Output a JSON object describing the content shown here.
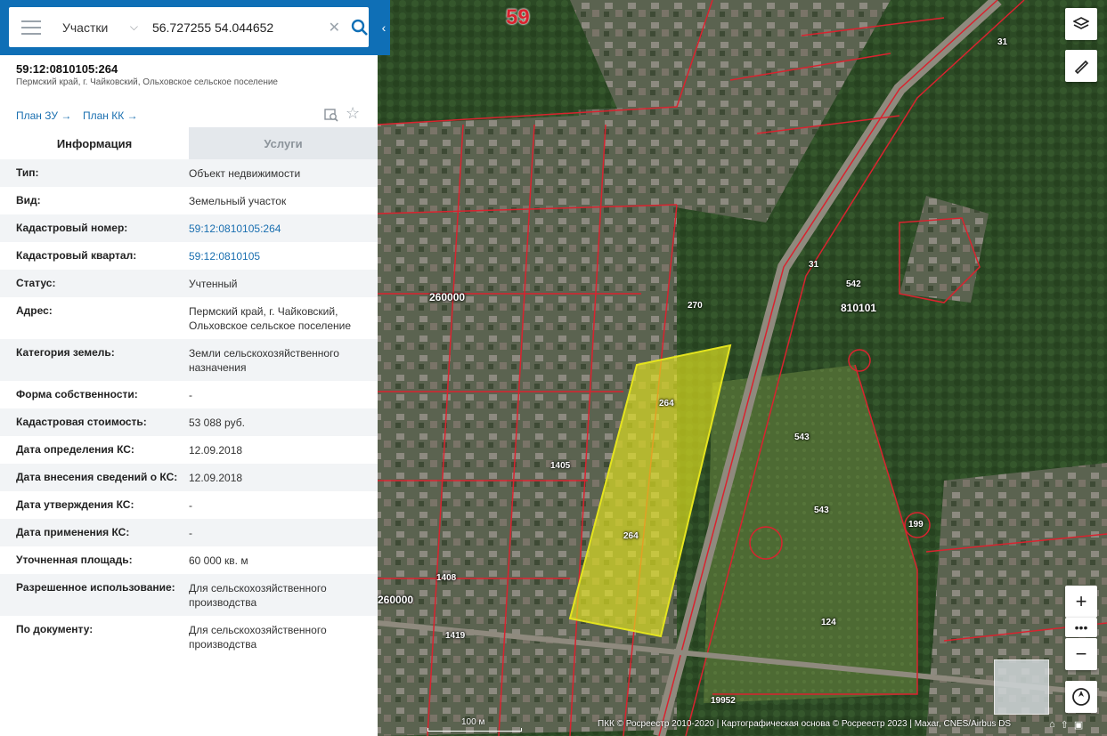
{
  "search": {
    "layer": "Участки",
    "query": "56.727255 54.044652"
  },
  "parcel": {
    "number": "59:12:0810105:264",
    "address_short": "Пермский край, г. Чайковский, Ольховское сельское поселение"
  },
  "links": {
    "plan_zu": "План ЗУ →",
    "plan_kk": "План КК →"
  },
  "tabs": {
    "info": "Информация",
    "services": "Услуги"
  },
  "rows": [
    {
      "k": "Тип:",
      "v": "Объект недвижимости"
    },
    {
      "k": "Вид:",
      "v": "Земельный участок"
    },
    {
      "k": "Кадастровый номер:",
      "v": "59:12:0810105:264"
    },
    {
      "k": "Кадастровый квартал:",
      "v": "59:12:0810105"
    },
    {
      "k": "Статус:",
      "v": "Учтенный"
    },
    {
      "k": "Адрес:",
      "v": "Пермский край, г. Чайковский, Ольховское сельское поселение"
    },
    {
      "k": "Категория земель:",
      "v": "Земли сельскохозяйственного назначения"
    },
    {
      "k": "Форма собственности:",
      "v": "-"
    },
    {
      "k": "Кадастровая стоимость:",
      "v": "53 088 руб."
    },
    {
      "k": "Дата определения КС:",
      "v": "12.09.2018"
    },
    {
      "k": "Дата внесения сведений о КС:",
      "v": "12.09.2018"
    },
    {
      "k": "Дата утверждения КС:",
      "v": "-"
    },
    {
      "k": "Дата применения КС:",
      "v": "-"
    },
    {
      "k": "Уточненная площадь:",
      "v": "60 000 кв. м"
    },
    {
      "k": "Разрешенное использование:",
      "v": "Для сельскохозяйственного производства"
    },
    {
      "k": "По документу:",
      "v": "Для сельскохозяйственного производства"
    }
  ],
  "map": {
    "labels": {
      "l59": "59",
      "l260000a": "260000",
      "l260000b": "260000",
      "l810101": "810101",
      "l264a": "264",
      "l264b": "264",
      "l543a": "543",
      "l543b": "543",
      "l124": "124",
      "l1419": "1419",
      "l1405": "1405",
      "l31a": "31",
      "l31b": "31",
      "l270": "270",
      "l542": "542",
      "l1408": "1408",
      "l199": "199",
      "l1995": "19952"
    },
    "scale": "100 м",
    "attribution": "ПКК © Росреестр 2010-2020 | Картографическая основа © Росреестр 2023 | Maxar, CNES/Airbus DS"
  },
  "colors": {
    "brand": "#0f6fb6",
    "parcel_fill": "#e5e51e",
    "boundary": "#d9232f"
  },
  "icons": [
    "menu-icon",
    "chevron-down-icon",
    "clear-icon",
    "search-icon",
    "collapse-icon",
    "print-icon",
    "star-icon",
    "layers-icon",
    "ruler-icon",
    "zoom-in-icon",
    "more-icon",
    "zoom-out-icon",
    "compass-icon"
  ]
}
